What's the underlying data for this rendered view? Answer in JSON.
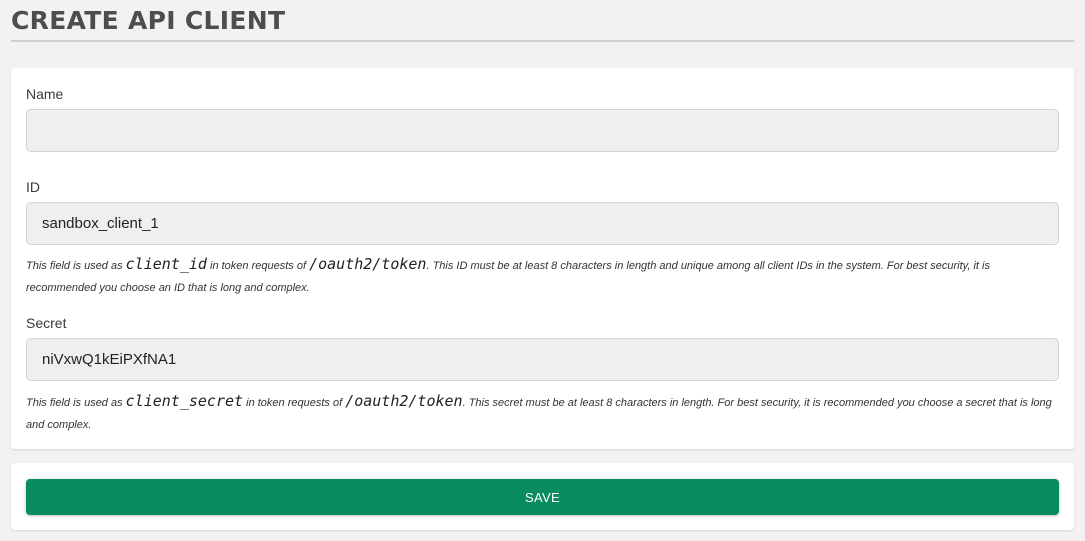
{
  "page": {
    "title": "CREATE API CLIENT"
  },
  "form": {
    "name": {
      "label": "Name",
      "value": "",
      "placeholder": ""
    },
    "id": {
      "label": "ID",
      "value": "sandbox_client_1",
      "help": {
        "prefix": "This field is used as ",
        "code1": "client_id",
        "middle": " in token requests of ",
        "code2": "/oauth2/token",
        "suffix": ". This ID must be at least 8 characters in length and unique among all client IDs in the system. For best security, it is recommended you choose an ID that is long and complex."
      }
    },
    "secret": {
      "label": "Secret",
      "value": "niVxwQ1kEiPXfNA1",
      "help": {
        "prefix": "This field is used as ",
        "code1": "client_secret",
        "middle": " in token requests of ",
        "code2": "/oauth2/token",
        "suffix": ". This secret must be at least 8 characters in length. For best security, it is recommended you choose a secret that is long and complex."
      }
    }
  },
  "actions": {
    "save_label": "SAVE"
  },
  "colors": {
    "primary": "#098b62",
    "background": "#f2f2f2",
    "input_background": "#efefef"
  }
}
